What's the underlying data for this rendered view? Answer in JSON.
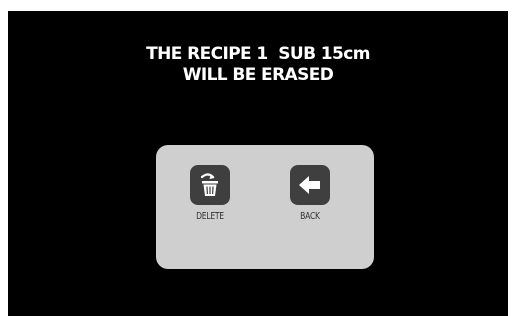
{
  "dialog": {
    "message_line1": "THE RECIPE 1  SUB 15cm",
    "message_line2": "WILL BE ERASED",
    "delete_label": "DELETE",
    "back_label": "BACK",
    "delete_icon": "trash-icon",
    "back_icon": "arrow-left-icon"
  },
  "colors": {
    "screen_background": "#000000",
    "message_text": "#ffffff",
    "panel_background": "#cfcfcf",
    "icon_tile": "#3f3f3f",
    "label_text": "#333333"
  }
}
